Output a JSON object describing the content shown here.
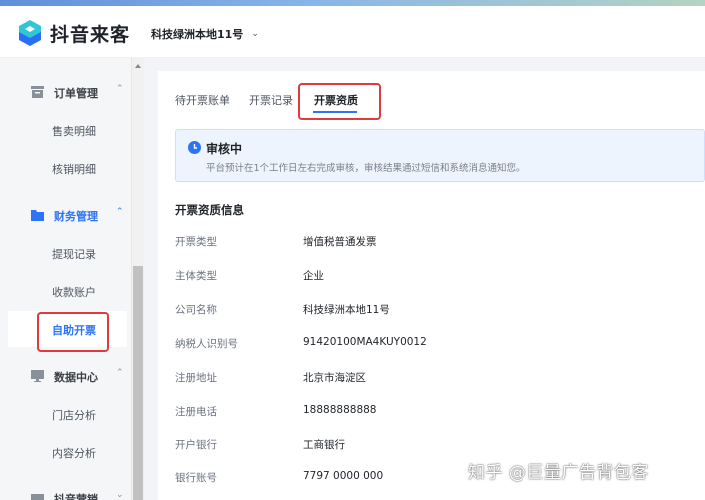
{
  "app": {
    "logo_text": "抖音来客",
    "shop_name": "科技绿洲本地11号"
  },
  "sidebar": {
    "groups": [
      {
        "label": "订单管理",
        "icon": "order-icon",
        "items": [
          "售卖明细",
          "核销明细"
        ]
      },
      {
        "label": "财务管理",
        "icon": "finance-folder-icon",
        "items": [
          "提现记录",
          "收款账户",
          "自助开票"
        ],
        "active_item": "自助开票"
      },
      {
        "label": "数据中心",
        "icon": "data-icon",
        "items": [
          "门店分析",
          "内容分析"
        ]
      },
      {
        "label": "抖音营销",
        "icon": "marketing-icon",
        "items": []
      }
    ]
  },
  "tabs": [
    {
      "label": "待开票账单"
    },
    {
      "label": "开票记录"
    },
    {
      "label": "开票资质",
      "active": true
    }
  ],
  "notice": {
    "title": "审核中",
    "desc": "平台预计在1个工作日左右完成审核，审核结果通过短信和系统消息通知您。"
  },
  "section": {
    "title": "开票资质信息",
    "fields": [
      {
        "label": "开票类型",
        "value": "增值税普通发票"
      },
      {
        "label": "主体类型",
        "value": "企业"
      },
      {
        "label": "公司名称",
        "value": "科技绿洲本地11号"
      },
      {
        "label": "纳税人识别号",
        "value": "91420100MA4KUY0012"
      },
      {
        "label": "注册地址",
        "value": "北京市海淀区"
      },
      {
        "label": "注册电话",
        "value": "18888888888"
      },
      {
        "label": "开户银行",
        "value": "工商银行"
      },
      {
        "label": "银行账号",
        "value": "7797 0000 000"
      }
    ]
  },
  "watermark": "知乎 @巨量广告背包客",
  "colors": {
    "accent": "#2d73f5",
    "highlight_box": "#e0393e",
    "notice_bg": "#eef4fe"
  }
}
